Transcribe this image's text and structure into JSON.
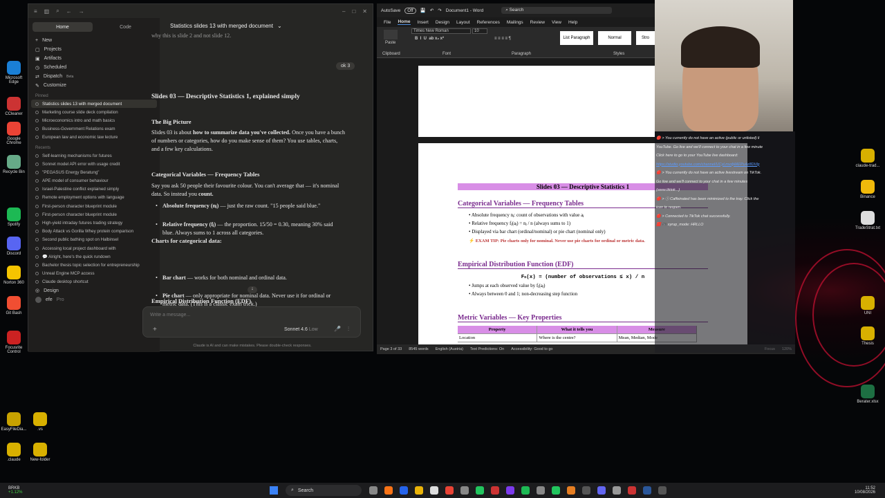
{
  "claude": {
    "app_title": "Statistics slides 13 with merged document",
    "home": "Home",
    "code": "Code",
    "nav": [
      "New",
      "Projects",
      "Artifacts",
      "Scheduled",
      "Dispatch",
      "Customize"
    ],
    "dispatch_badge": "Beta",
    "pinned_label": "Pinned",
    "pinned": [
      "Statistics slides 13 with merged document",
      "Marketing course slide deck compilation",
      "Microeconomics intro and math basics",
      "Business-Government Relations exam",
      "European law and economic law lecture"
    ],
    "recents_label": "Recents",
    "recents": [
      "Self-learning mechanisms for futures",
      "Sonnet model API error with usage credit",
      "\"PEGASUS Energy Beratung\"",
      "APE model of consumer behaviour",
      "Israel-Palestine conflict explained simply",
      "Remote employment options with language",
      "First-person character blueprint module",
      "First-person character blueprint module",
      "High-yield intraday futures trading strategy",
      "Body Attack vs Gorilla Whey protein comparison",
      "Second public bathing spot on Halbinsel",
      "Accessing local project dashboard with",
      "💬 Alright, here's the quick rundown",
      "Bachelor thesis topic selection for entrepreneurship",
      "Unreal Engine MCP access",
      "Claude desktop shortcut"
    ],
    "design": "Design",
    "user": "efe",
    "plan": "Pro",
    "prev_line": "why this is slide 2 and not slide 12.",
    "user_msg": "ok 3",
    "title": "Slides 03 — Descriptive Statistics 1, explained simply",
    "bp_head": "The Big Picture",
    "bp_a": "Slides 03 is about ",
    "bp_b": "how to summarize data you've collected.",
    "bp_c": " Once you have a bunch of numbers or categories, how do you make sense of them? You use tables, charts, and a few key calculations.",
    "cv_head": "Categorical Variables — Frequency Tables",
    "cv_a": "Say you ask 50 people their favourite colour. You can't average that — it's nominal data. So instead you ",
    "cv_b": "count.",
    "b1a": "Absolute frequency (nⱼ)",
    "b1b": " — just the raw count. \"15 people said blue.\"",
    "b2a": "Relative frequency (fⱼ)",
    "b2b": " — the proportion. 15/50 = 0.30, meaning 30% said blue. Always sums to 1 across all categories.",
    "charts_head": "Charts for categorical data:",
    "c1a": "Bar chart",
    "c1b": " — works for both nominal and ordinal data.",
    "c2a": "Pie chart",
    "c2b": " — only appropriate for nominal data. Never use it for ordinal or metric data. (This is a classic exam trick.)",
    "edf_head": "Empirical Distribution Function (EDF)",
    "placeholder": "Write a message...",
    "model": "Sonnet 4.6",
    "effort": "Low",
    "disclaimer": "Claude is AI and can make mistakes. Please double-check responses."
  },
  "word": {
    "autosave": "AutoSave",
    "toggle": "Off",
    "doc": "Document1 - Word",
    "search": "Search",
    "menu": [
      "File",
      "Home",
      "Insert",
      "Design",
      "Layout",
      "References",
      "Mailings",
      "Review",
      "View",
      "Help"
    ],
    "font": "Times New Roman",
    "size": "10",
    "paste": "Paste",
    "clipboard": "Clipboard",
    "fontgrp": "Font",
    "paragraph": "Paragraph",
    "styles": "Styles",
    "style1": "List Paragraph",
    "style2": "Normal",
    "style3": "Stro",
    "band": "Slides 03 — Descriptive Statistics 1",
    "h1": "Categorical Variables — Frequency Tables",
    "l1": "• Absolute frequency nⱼ: count of observations with value aⱼ",
    "l2": "• Relative frequency fⱼ(aⱼ) = nⱼ / n (always sums to 1)",
    "l3": "• Displayed via bar chart (ordinal/nominal) or pie chart (nominal only)",
    "tip": "⚡ EXAM TIP: Pie charts only for nominal. Never use pie charts for ordinal or metric data.",
    "h2": "Empirical Distribution Function (EDF)",
    "formula": "Fₙ(x) = (number of observations ≤ x) / n",
    "l4": "• Jumps at each observed value by fⱼ(aⱼ)",
    "l5": "• Always between 0 and 1; non-decreasing step function",
    "h3": "Metric Variables — Key Properties",
    "th": [
      "Property",
      "What it tells you",
      "Measure"
    ],
    "tr": [
      "Location",
      "Where is the centre?",
      "Mean, Median, Mode"
    ],
    "status": [
      "Page 3 of 33",
      "8545 words",
      "English (Austria)",
      "Text Predictions: On",
      "Accessibility: Good to go",
      "Focus",
      "120%"
    ]
  },
  "chatlog": [
    "🔴 > You currently do not have an active (public or unlisted) li",
    "YouTube. Go live and we'll connect to your chat in a few minute",
    "Click here to go to your YouTube live dashboard:",
    "https://studio.youtube.com/channel/UCyLmvdj4AFPu4z8DVlg",
    "🔴 > You currently do not have an active livestream on TikTok.",
    "Go live and we'll connect to your chat in a few minutes",
    "(www.tiktok...)",
    "🔴 > ⓘ Caffeinated has been minimized to the tray. Click the",
    "icon to reopen.",
    "🔴 > Connected to TikTok chat successfully.",
    "🟥 🎮 xyrup_mode: HRLLO"
  ],
  "desktop": [
    "Microsoft Edge",
    "CCleaner",
    "Google Chrome",
    "Recycle Bin",
    "Spotify",
    "Discord",
    "Norton 360",
    "Git Bash",
    "Focusrite Control",
    "EasyFileDia...",
    ".vs",
    ".claude",
    "New-folder",
    "claude-trad...",
    "Binance",
    "TradeStrat.txt",
    "UNI",
    "Thesis",
    "Berater.xlsx"
  ],
  "taskbar": {
    "search": "Search",
    "stock": "BRKB",
    "stock_chg": "+1.12%",
    "time": "11:52",
    "date": "10/08/2026"
  }
}
